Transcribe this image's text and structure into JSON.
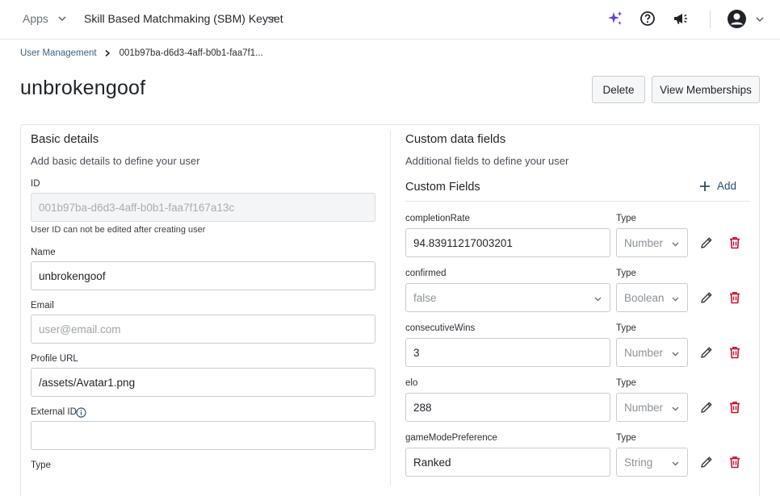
{
  "topbar": {
    "apps_label": "Apps",
    "keyset_label": "Skill Based Matchmaking (SBM) Keyset",
    "icons": [
      "sparkle-icon",
      "help-icon",
      "megaphone-icon",
      "account-icon",
      "chevron-down-icon"
    ]
  },
  "breadcrumb": {
    "parent": "User Management",
    "current": "001b97ba-d6d3-4aff-b0b1-faa7f1..."
  },
  "page": {
    "title": "unbrokengoof",
    "delete_label": "Delete",
    "memberships_label": "View Memberships"
  },
  "basic": {
    "title": "Basic details",
    "subtitle": "Add basic details to define your user",
    "id_label": "ID",
    "id_value": "001b97ba-d6d3-4aff-b0b1-faa7f167a13c",
    "id_helper": "User ID can not be edited after creating user",
    "name_label": "Name",
    "name_value": "unbrokengoof",
    "email_label": "Email",
    "email_placeholder": "user@email.com",
    "profile_label": "Profile URL",
    "profile_value": "/assets/Avatar1.png",
    "external_label": "External ID",
    "external_value": "",
    "type_label": "Type"
  },
  "custom": {
    "title": "Custom data fields",
    "subtitle": "Additional fields to define your user",
    "header": "Custom Fields",
    "add_label": "Add",
    "type_label": "Type",
    "fields": [
      {
        "name": "completionRate",
        "value": "94.83911217003201",
        "type": "Number",
        "is_select": false
      },
      {
        "name": "confirmed",
        "value": "false",
        "type": "Boolean",
        "is_select": true
      },
      {
        "name": "consecutiveWins",
        "value": "3",
        "type": "Number",
        "is_select": false
      },
      {
        "name": "elo",
        "value": "288",
        "type": "Number",
        "is_select": false
      },
      {
        "name": "gameModePreference",
        "value": "Ranked",
        "type": "String",
        "is_select": false
      }
    ]
  },
  "colors": {
    "accent": "#2a4f6e",
    "danger": "#c8102e",
    "sparkle": "#6c3fd1"
  }
}
